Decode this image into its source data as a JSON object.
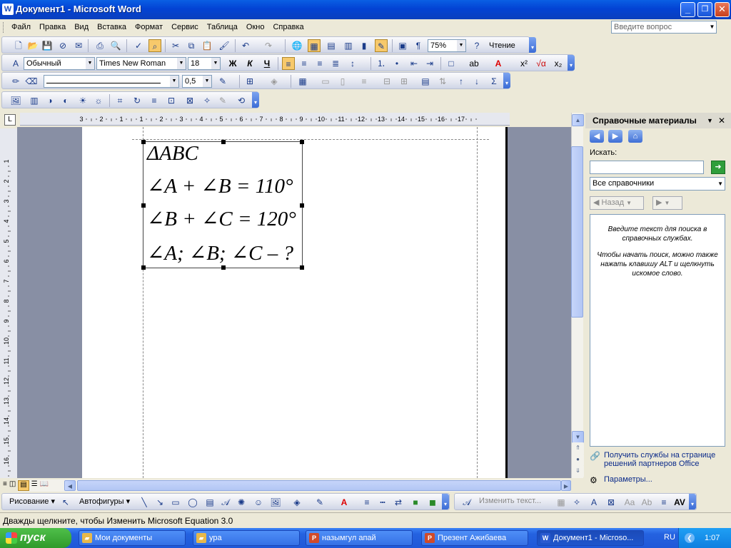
{
  "window": {
    "title": "Документ1 - Microsoft Word",
    "app_icon": "W",
    "minimize": "_",
    "restore": "❐",
    "close": "✕"
  },
  "menu": {
    "items": [
      "Файл",
      "Правка",
      "Вид",
      "Вставка",
      "Формат",
      "Сервис",
      "Таблица",
      "Окно",
      "Справка"
    ],
    "help_placeholder": "Введите вопрос"
  },
  "standard_toolbar": {
    "zoom": "75%",
    "reading_label": "Чтение"
  },
  "format_toolbar": {
    "style": "Обычный",
    "font": "Times New Roman",
    "size": "18",
    "bold": "Ж",
    "italic": "К",
    "underline": "Ч"
  },
  "tables_toolbar": {
    "line_width": "0,5",
    "sum": "Σ"
  },
  "ruler": {
    "h_labels": [
      "3",
      "2",
      "1",
      "1",
      "2",
      "3",
      "4",
      "5",
      "6",
      "7",
      "8",
      "9",
      "10",
      "11",
      "12",
      "13",
      "14",
      "15",
      "16",
      "17"
    ],
    "v_labels": [
      "1",
      "2",
      "3",
      "4",
      "5",
      "6",
      "7",
      "8",
      "9",
      "10",
      "11",
      "12",
      "13",
      "14",
      "15",
      "16"
    ]
  },
  "equation": {
    "lines": [
      "ΔABC",
      "∠A + ∠B = 110°",
      "∠B + ∠C = 120°",
      "∠A; ∠B; ∠C – ?"
    ]
  },
  "task_pane": {
    "title": "Справочные материалы",
    "search_label": "Искать:",
    "search_value": "",
    "source": "Все справочники",
    "back": "Назад",
    "results_text_1": "Введите текст для поиска в справочных службах.",
    "results_text_2": "Чтобы начать поиск, можно также нажать клавишу ALT и щелкнуть искомое слово.",
    "link_services": "Получить службы на странице решений партнеров Office",
    "link_params": "Параметры..."
  },
  "drawing_toolbar": {
    "draw": "Рисование",
    "autoshapes": "Автофигуры",
    "edit_text": "Изменить текст..."
  },
  "status": {
    "text": "Дважды щелкните, чтобы Изменить Microsoft Equation 3.0"
  },
  "taskbar": {
    "start": "пуск",
    "tasks": [
      {
        "label": "Мои документы"
      },
      {
        "label": "ура"
      },
      {
        "label": "назымгул апай"
      },
      {
        "label": "Презент Ажибаева"
      },
      {
        "label": "Документ1 - Microso..."
      }
    ],
    "lang": "RU",
    "time": "1:07"
  },
  "colors": {
    "title_bar": "#0a5fe4",
    "taskbar": "#245edc",
    "start": "#3aa336",
    "highlight": "#f7c96b"
  }
}
